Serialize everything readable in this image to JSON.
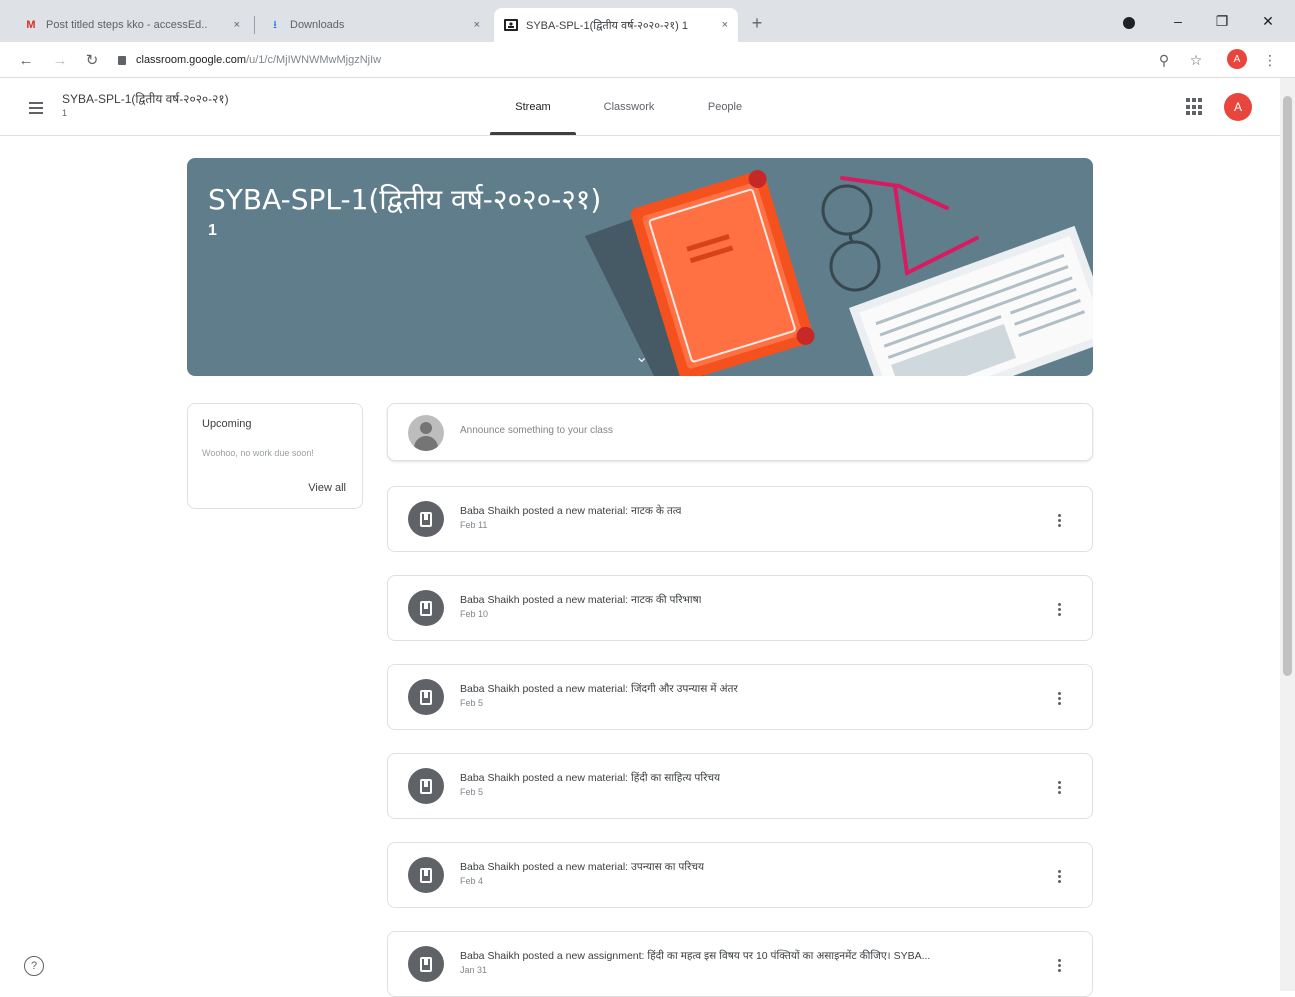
{
  "browser": {
    "tabs": [
      {
        "title": "Post titled steps kko - accessEd..",
        "icon": "gmail-icon",
        "active": false
      },
      {
        "title": "Downloads",
        "icon": "download-icon",
        "active": false
      },
      {
        "title": "SYBA-SPL-1(द्वितीय वर्ष-२०२०-२१) 1",
        "icon": "classroom-icon",
        "active": true
      }
    ],
    "close_glyph": "×",
    "new_tab_glyph": "+",
    "window_controls": {
      "minimize": "–",
      "maximize": "❐",
      "close": "✕"
    },
    "url_host": "classroom.google.com",
    "url_path": "/u/1/c/MjIWNWMwMjgzNjIw",
    "nav_glyphs": {
      "back": "←",
      "forward": "→",
      "reload": "↻"
    },
    "address_icons": {
      "zoom": "⚲",
      "bookmark": "☆",
      "menu": "⋮"
    },
    "profile_initial": "A"
  },
  "header": {
    "class_name": "SYBA-SPL-1(द्वितीय वर्ष-२०२०-२१)",
    "section": "1",
    "tabs": [
      "Stream",
      "Classwork",
      "People"
    ],
    "active_tab": "Stream",
    "avatar_initial": "A"
  },
  "banner": {
    "title": "SYBA-SPL-1(द्वितीय वर्ष-२०२०-२१)",
    "section": "1",
    "expand_glyph": "⌄",
    "color": "#607d8b"
  },
  "upcoming": {
    "title": "Upcoming",
    "text": "Woohoo, no work due soon!",
    "link": "View all"
  },
  "announce": {
    "placeholder": "Announce something to your class"
  },
  "posts": [
    {
      "text": "Baba Shaikh posted a new material: नाटक के तत्व",
      "date": "Feb 11"
    },
    {
      "text": "Baba Shaikh posted a new material: नाटक की परिभाषा",
      "date": "Feb 10"
    },
    {
      "text": "Baba Shaikh posted a new material: जिंदगी और उपन्यास में अंतर",
      "date": "Feb 5"
    },
    {
      "text": "Baba Shaikh posted a new material: हिंदी का साहित्य परिचय",
      "date": "Feb 5"
    },
    {
      "text": "Baba Shaikh posted a new material: उपन्यास का परिचय",
      "date": "Feb 4"
    },
    {
      "text": "Baba Shaikh posted a new assignment: हिंदी का महत्व इस विषय पर 10 पंक्तियों का असाइनमेंट कीजिए। SYBA...",
      "date": "Jan 31"
    }
  ],
  "help_glyph": "?"
}
